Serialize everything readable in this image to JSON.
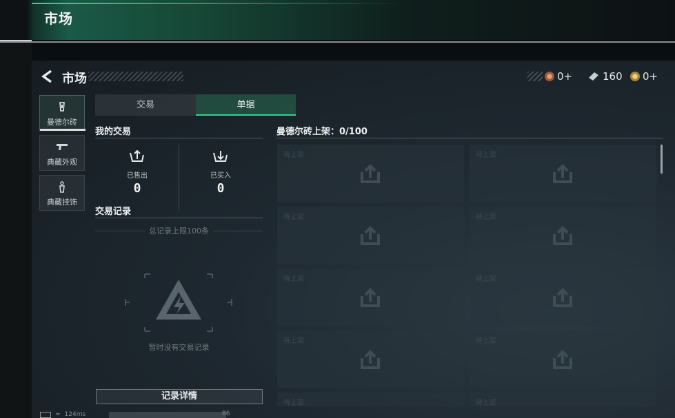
{
  "topbar": {
    "title": "市场"
  },
  "header": {
    "title": "市场"
  },
  "currencies": [
    {
      "icon": "bronze-coin-icon",
      "value": "0+"
    },
    {
      "icon": "ticket-icon",
      "value": "160"
    },
    {
      "icon": "gold-coin-icon",
      "value": "0+"
    }
  ],
  "sidebar": {
    "items": [
      {
        "label": "曼德尔砖",
        "icon": "mandel-brick-icon",
        "active": true
      },
      {
        "label": "典藏外观",
        "icon": "gun-icon",
        "active": false
      },
      {
        "label": "典藏挂饰",
        "icon": "charm-icon",
        "active": false
      }
    ]
  },
  "tabs": [
    {
      "label": "交易",
      "active": false
    },
    {
      "label": "单据",
      "active": true
    }
  ],
  "my_trades": {
    "title": "我的交易",
    "sold_label": "已售出",
    "sold_value": "0",
    "bought_label": "已买入",
    "bought_value": "0"
  },
  "records": {
    "title": "交易记录",
    "limit_note": "总记录上限100条",
    "empty_text": "暂时没有交易记录",
    "detail_button": "记录详情"
  },
  "listings": {
    "title": "曼德尔砖上架：0/100",
    "slot_label": "待上架",
    "slots": [
      "待上架",
      "待上架",
      "待上架",
      "待上架",
      "待上架",
      "待上架",
      "待上架",
      "待上架",
      "待上架",
      "待上架"
    ]
  },
  "status": {
    "ping": "124ms",
    "number": "86"
  },
  "colors": {
    "accent": "#3bd08e",
    "panel": "#1e2830"
  }
}
